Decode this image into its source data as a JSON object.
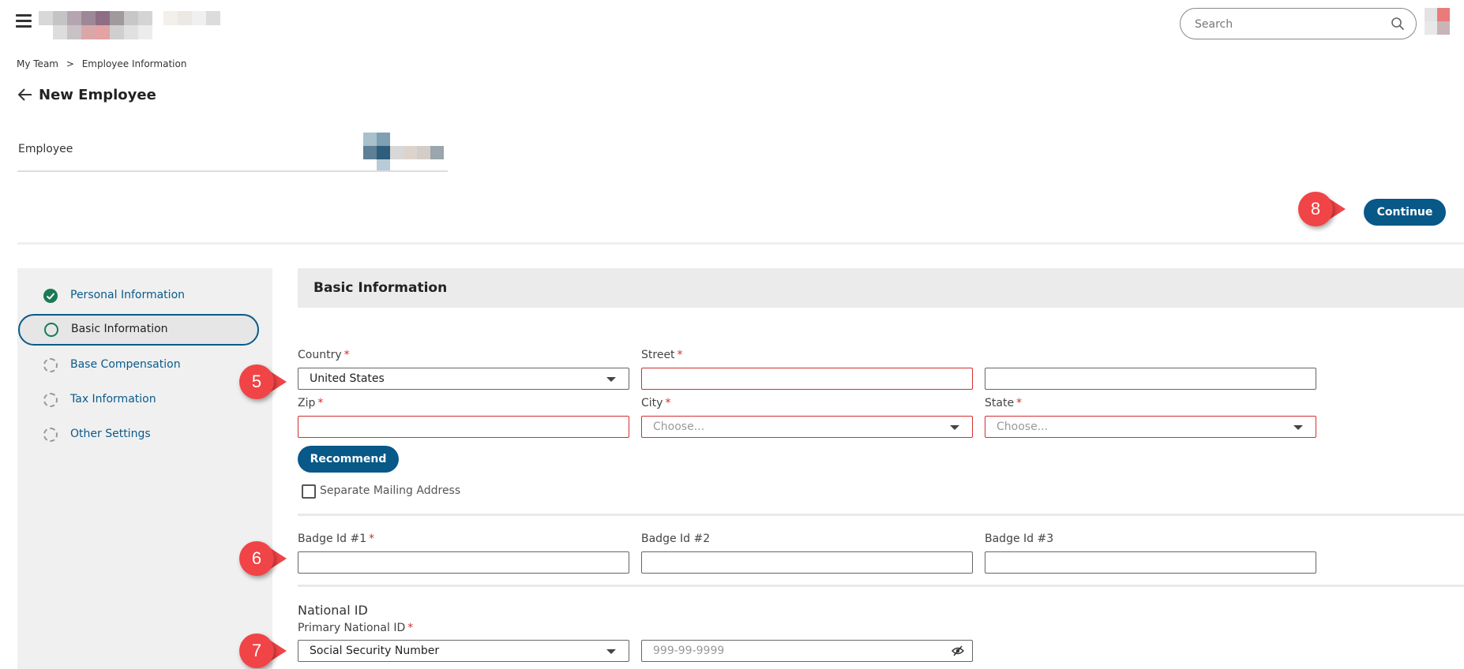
{
  "header": {
    "search": {
      "placeholder": "Search",
      "value": ""
    }
  },
  "breadcrumb": {
    "items": [
      "My Team",
      "Employee Information"
    ],
    "separator": ">"
  },
  "page": {
    "title": "New Employee",
    "employee_label": "Employee"
  },
  "actions": {
    "continue_label": "Continue",
    "recommend_label": "Recommend"
  },
  "sidebar": {
    "steps": [
      {
        "label": "Personal Information",
        "status": "complete"
      },
      {
        "label": "Basic Information",
        "status": "current"
      },
      {
        "label": "Base Compensation",
        "status": "pending"
      },
      {
        "label": "Tax Information",
        "status": "pending"
      },
      {
        "label": "Other Settings",
        "status": "pending"
      }
    ]
  },
  "section": {
    "title": "Basic Information"
  },
  "address": {
    "country": {
      "label": "Country",
      "required_mark": "*",
      "value": "United States"
    },
    "street": {
      "label": "Street",
      "required_mark": "*",
      "value": ""
    },
    "street2": {
      "value": ""
    },
    "zip": {
      "label": "Zip",
      "required_mark": "*",
      "value": ""
    },
    "city": {
      "label": "City",
      "required_mark": "*",
      "placeholder": "Choose..."
    },
    "state": {
      "label": "State",
      "required_mark": "*",
      "placeholder": "Choose..."
    },
    "separate_mailing": {
      "label": "Separate Mailing Address",
      "checked": false
    }
  },
  "badges": {
    "badge1": {
      "label": "Badge Id #1",
      "required_mark": "*",
      "value": ""
    },
    "badge2": {
      "label": "Badge Id #2",
      "value": ""
    },
    "badge3": {
      "label": "Badge Id #3",
      "value": ""
    }
  },
  "national_id": {
    "title": "National ID",
    "primary": {
      "label": "Primary National ID",
      "required_mark": "*",
      "value": "Social Security Number"
    },
    "number": {
      "placeholder": "999-99-9999",
      "value": ""
    }
  },
  "callouts": [
    "5",
    "6",
    "7",
    "8"
  ],
  "colors": {
    "primary": "#085888",
    "link": "#0a5a8a",
    "success": "#1b7a55",
    "error": "#d32f2f",
    "callout": "#f04446"
  }
}
